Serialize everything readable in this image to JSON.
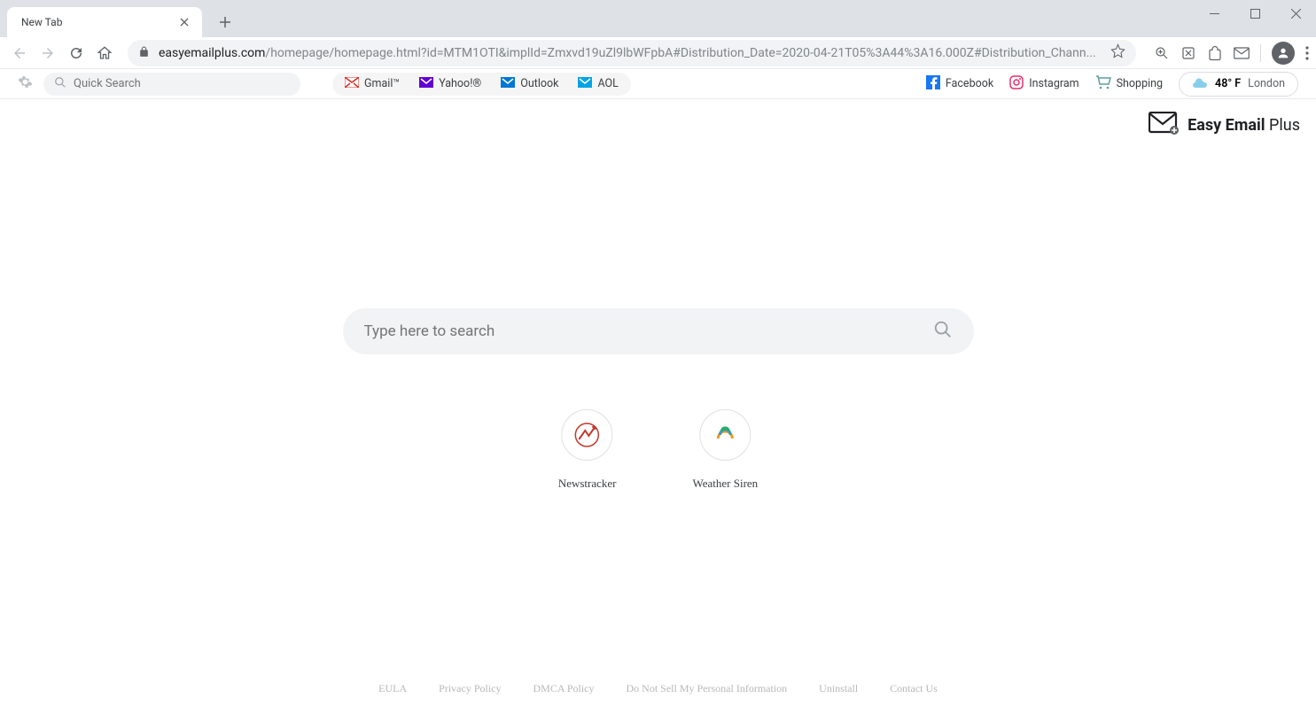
{
  "tab": {
    "title": "New Tab"
  },
  "url": {
    "domain": "easyemailplus.com",
    "path": "/homepage/homepage.html?id=MTM1OTI&implId=Zmxvd19uZl9lbWFpbA#Distribution_Date=2020-04-21T05%3A44%3A16.000Z#Distribution_Chann..."
  },
  "extbar": {
    "quick_search_placeholder": "Quick Search",
    "email_links": [
      {
        "label": "Gmail™"
      },
      {
        "label": "Yahoo!®"
      },
      {
        "label": "Outlook"
      },
      {
        "label": "AOL"
      }
    ],
    "social": [
      {
        "label": "Facebook"
      },
      {
        "label": "Instagram"
      },
      {
        "label": "Shopping"
      }
    ],
    "weather": {
      "temp": "48° F",
      "location": "London"
    }
  },
  "brand": {
    "main": "Easy Email",
    "suffix": "Plus"
  },
  "main_search": {
    "placeholder": "Type here to search"
  },
  "shortcuts": [
    {
      "label": "Newstracker"
    },
    {
      "label": "Weather Siren"
    }
  ],
  "footer": [
    "EULA",
    "Privacy Policy",
    "DMCA Policy",
    "Do Not Sell My Personal Information",
    "Uninstall",
    "Contact Us"
  ]
}
